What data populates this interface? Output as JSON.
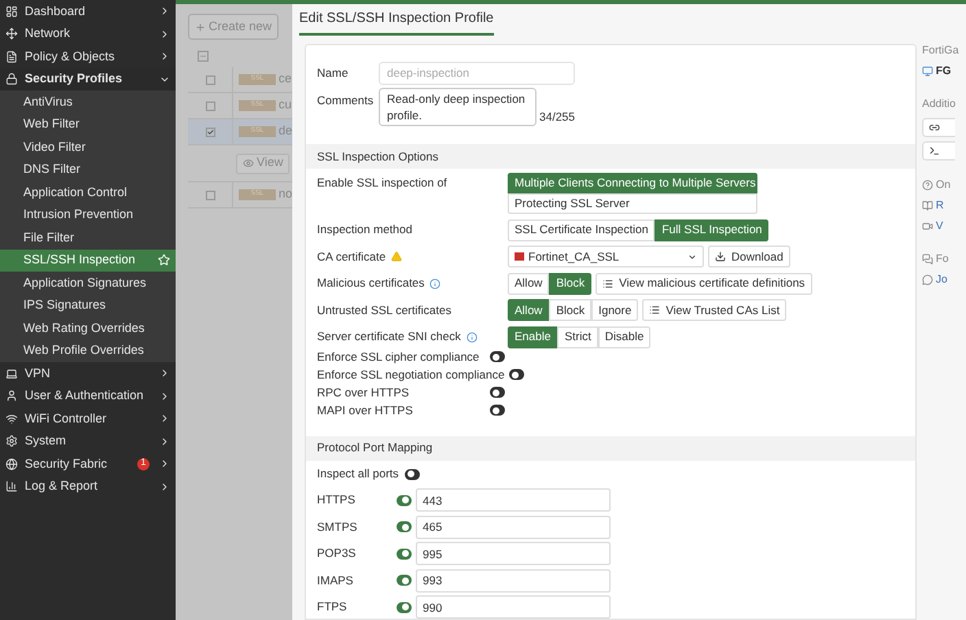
{
  "sidebar": {
    "items": [
      {
        "label": "Dashboard",
        "expanded": false,
        "selected": false
      },
      {
        "label": "Network",
        "expanded": false,
        "selected": false
      },
      {
        "label": "Policy & Objects",
        "expanded": false,
        "selected": false
      },
      {
        "label": "Security Profiles",
        "expanded": true,
        "selected": false,
        "children": [
          {
            "label": "AntiVirus",
            "selected": false
          },
          {
            "label": "Web Filter",
            "selected": false
          },
          {
            "label": "Video Filter",
            "selected": false
          },
          {
            "label": "DNS Filter",
            "selected": false
          },
          {
            "label": "Application Control",
            "selected": false
          },
          {
            "label": "Intrusion Prevention",
            "selected": false
          },
          {
            "label": "File Filter",
            "selected": false
          },
          {
            "label": "SSL/SSH Inspection",
            "selected": true
          },
          {
            "label": "Application Signatures",
            "selected": false
          },
          {
            "label": "IPS Signatures",
            "selected": false
          },
          {
            "label": "Web Rating Overrides",
            "selected": false
          },
          {
            "label": "Web Profile Overrides",
            "selected": false
          }
        ]
      },
      {
        "label": "VPN",
        "expanded": false,
        "selected": false
      },
      {
        "label": "User & Authentication",
        "expanded": false,
        "selected": false
      },
      {
        "label": "WiFi Controller",
        "expanded": false,
        "selected": false
      },
      {
        "label": "System",
        "expanded": false,
        "selected": false
      },
      {
        "label": "Security Fabric",
        "expanded": false,
        "selected": false,
        "badge": "1"
      },
      {
        "label": "Log & Report",
        "expanded": false,
        "selected": false
      }
    ]
  },
  "list": {
    "create_button": "Create new",
    "rows": [
      {
        "kind": "profile",
        "badge": "SSL",
        "name": "ce",
        "checked": false,
        "selected": false
      },
      {
        "kind": "profile",
        "badge": "SSL",
        "name": "cu",
        "checked": false,
        "selected": false
      },
      {
        "kind": "profile",
        "badge": "SSL",
        "name": "de",
        "checked": true,
        "selected": true
      },
      {
        "kind": "action",
        "label": "View"
      },
      {
        "kind": "profile",
        "badge": "SSL",
        "name": "no",
        "checked": false,
        "selected": false
      }
    ]
  },
  "dialog": {
    "title": "Edit SSL/SSH Inspection Profile",
    "name": {
      "label": "Name",
      "value": "deep-inspection",
      "disabled": true
    },
    "comments": {
      "label": "Comments",
      "value": "Read-only deep inspection profile.",
      "counter": "34/255"
    },
    "sections": [
      {
        "title": "SSL Inspection Options",
        "rows": [
          {
            "kind": "stacked",
            "label": "Enable SSL inspection of",
            "options": [
              {
                "label": "Multiple Clients Connecting to Multiple Servers",
                "selected": true
              },
              {
                "label": "Protecting SSL Server",
                "selected": false
              }
            ]
          },
          {
            "kind": "segmented",
            "label": "Inspection method",
            "options": [
              {
                "label": "SSL Certificate Inspection",
                "selected": false
              },
              {
                "label": "Full SSL Inspection",
                "selected": true
              }
            ]
          },
          {
            "kind": "select",
            "label": "CA certificate",
            "warning": true,
            "value": "Fortinet_CA_SSL",
            "button": "Download"
          },
          {
            "kind": "segmented",
            "label": "Malicious certificates",
            "info": true,
            "options": [
              {
                "label": "Allow",
                "selected": false
              },
              {
                "label": "Block",
                "selected": true
              }
            ],
            "button": "View malicious certificate definitions"
          },
          {
            "kind": "segmented",
            "label": "Untrusted SSL certificates",
            "options": [
              {
                "label": "Allow",
                "selected": true
              },
              {
                "label": "Block",
                "selected": false
              },
              {
                "label": "Ignore",
                "selected": false
              }
            ],
            "button": "View Trusted CAs List"
          },
          {
            "kind": "segmented",
            "label": "Server certificate SNI check",
            "info": true,
            "options": [
              {
                "label": "Enable",
                "selected": true
              },
              {
                "label": "Strict",
                "selected": false
              },
              {
                "label": "Disable",
                "selected": false
              }
            ]
          },
          {
            "kind": "toggle",
            "label": "Enforce SSL cipher compliance",
            "on": false
          },
          {
            "kind": "toggle",
            "label": "Enforce SSL negotiation compliance",
            "on": false
          },
          {
            "kind": "toggle",
            "label": "RPC over HTTPS",
            "on": false
          },
          {
            "kind": "toggle",
            "label": "MAPI over HTTPS",
            "on": false
          }
        ]
      },
      {
        "title": "Protocol Port Mapping",
        "rows": [
          {
            "kind": "inline_toggle",
            "label": "Inspect all ports",
            "on": false
          },
          {
            "kind": "port",
            "label": "HTTPS",
            "on": true,
            "value": "443"
          },
          {
            "kind": "port",
            "label": "SMTPS",
            "on": true,
            "value": "465"
          },
          {
            "kind": "port",
            "label": "POP3S",
            "on": true,
            "value": "995"
          },
          {
            "kind": "port",
            "label": "IMAPS",
            "on": true,
            "value": "993"
          },
          {
            "kind": "port",
            "label": "FTPS",
            "on": true,
            "value": "990"
          }
        ]
      }
    ]
  },
  "side_panel": {
    "sections": [
      {
        "kind": "device",
        "title": "FortiGa",
        "items": [
          "FG"
        ]
      },
      {
        "kind": "tools",
        "title": "Additio"
      },
      {
        "kind": "help",
        "title": "On",
        "items": [
          "R",
          "V"
        ]
      },
      {
        "kind": "forum",
        "title": "Fo",
        "items": [
          "Jo"
        ]
      }
    ]
  }
}
